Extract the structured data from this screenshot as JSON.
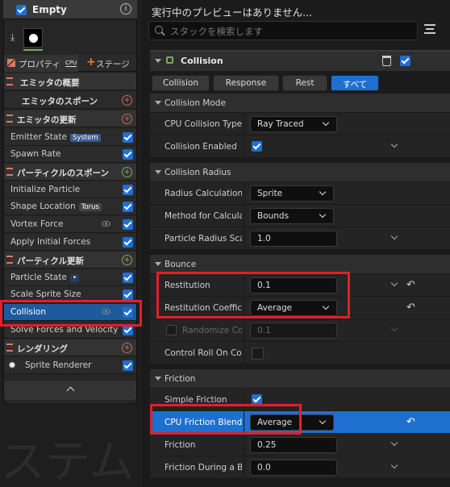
{
  "emitter": {
    "name": "Empty",
    "tabs": {
      "properties": "プロパティ",
      "cpu_badge": "CPU",
      "stage": "ステージ"
    },
    "sections": [
      {
        "label": "エミッタの概要"
      },
      {
        "label": "エミッタのスポーン"
      },
      {
        "label": "エミッタの更新"
      },
      {
        "label": "パーティクルのスポーン"
      },
      {
        "label": "パーティクル更新"
      },
      {
        "label": "レンダリング"
      }
    ],
    "items": {
      "emitter_state": "Emitter State",
      "emitter_state_tag": "System",
      "spawn_rate": "Spawn Rate",
      "initialize_particle": "Initialize Particle",
      "shape_location": "Shape Location",
      "shape_location_tag": "Torus",
      "vortex_force": "Vortex Force",
      "apply_initial_forces": "Apply Initial Forces",
      "particle_state": "Particle State",
      "scale_sprite_size": "Scale Sprite Size",
      "collision": "Collision",
      "solve_forces": "Solve Forces and Velocity",
      "sprite_renderer": "Sprite Renderer"
    },
    "bg_watermark": "ステム"
  },
  "right": {
    "preview_title": "実行中のプレビューはありません...",
    "search_placeholder": "スタックを検索します",
    "module_title": "Collision",
    "filter_tabs": [
      "Collision",
      "Response",
      "Rest",
      "すべて"
    ],
    "sections": {
      "mode": "Collision Mode",
      "radius": "Collision Radius",
      "bounce": "Bounce",
      "friction": "Friction"
    },
    "rows": {
      "cpu_type": {
        "label": "CPU Collision Type",
        "value": "Ray Traced"
      },
      "enabled": {
        "label": "Collision Enabled"
      },
      "radius_calc": {
        "label": "Radius Calculation",
        "value": "Sprite"
      },
      "method": {
        "label": "Method for Calcula",
        "value": "Bounds"
      },
      "particle_radius": {
        "label": "Particle Radius Sca",
        "value": "1.0"
      },
      "restitution": {
        "label": "Restitution",
        "value": "0.1"
      },
      "restitution_coef": {
        "label": "Restitution Coeffic",
        "value": "Average"
      },
      "randomize": {
        "label": "Randomize Co",
        "value": "0.1"
      },
      "control_roll": {
        "label": "Control Roll On Col"
      },
      "simple_friction": {
        "label": "Simple Friction"
      },
      "cpu_friction_blend": {
        "label": "CPU Friction Blend",
        "value": "Average"
      },
      "friction": {
        "label": "Friction",
        "value": "0.25"
      },
      "friction_during": {
        "label": "Friction During a Bo",
        "value": "0.0"
      }
    }
  }
}
